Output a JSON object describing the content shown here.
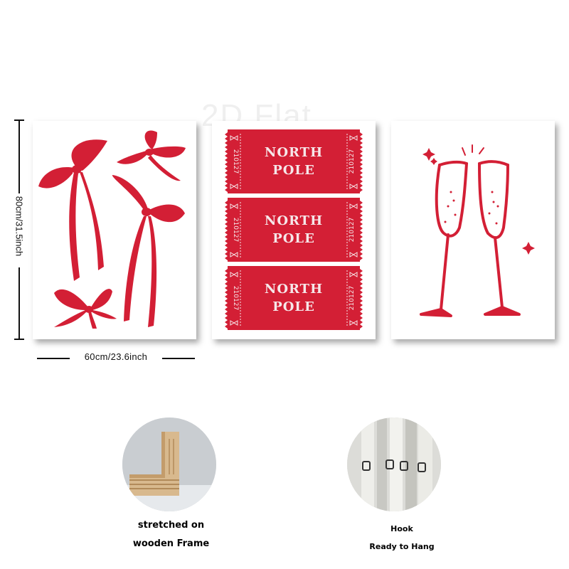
{
  "watermark": "2D Flat",
  "dimensions": {
    "width_label": "60cm/23.6inch",
    "height_label": "80cm/31.5inch"
  },
  "tickets": [
    {
      "line1": "NORTH",
      "line2": "POLE",
      "serial": "210127"
    },
    {
      "line1": "NORTH",
      "line2": "POLE",
      "serial": "210127"
    },
    {
      "line1": "NORTH",
      "line2": "POLE",
      "serial": "210127"
    }
  ],
  "features": {
    "frame_caption_1": "stretched on",
    "frame_caption_2": "wooden Frame",
    "hook_caption_1": "Hook",
    "hook_caption_2": "Ready to Hang"
  },
  "colors": {
    "accent_red": "#d31f35",
    "ticket_text": "#f6e7e9"
  }
}
